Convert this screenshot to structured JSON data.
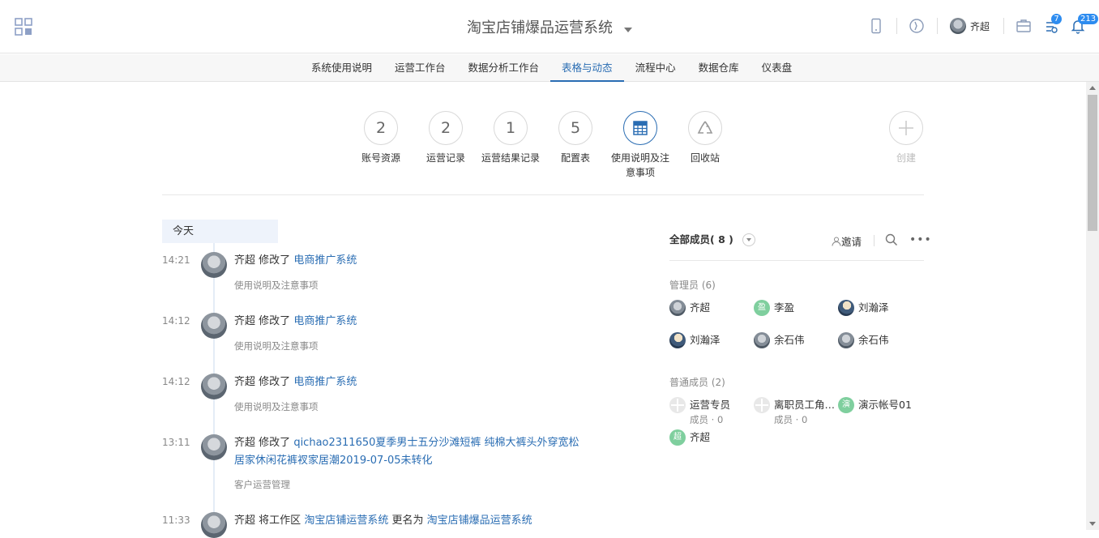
{
  "header": {
    "title": "淘宝店铺爆品运营系统",
    "user_name": "齐超",
    "badge_tasks": "7",
    "badge_notifications": "213"
  },
  "nav": {
    "tabs": [
      {
        "label": "系统使用说明",
        "active": false
      },
      {
        "label": "运营工作台",
        "active": false
      },
      {
        "label": "数据分析工作台",
        "active": false
      },
      {
        "label": "表格与动态",
        "active": true
      },
      {
        "label": "流程中心",
        "active": false
      },
      {
        "label": "数据仓库",
        "active": false
      },
      {
        "label": "仪表盘",
        "active": false
      }
    ]
  },
  "tiles": [
    {
      "value": "2",
      "label": "账号资源"
    },
    {
      "value": "2",
      "label": "运营记录"
    },
    {
      "value": "1",
      "label": "运营结果记录"
    },
    {
      "value": "5",
      "label": "配置表"
    },
    {
      "value": "",
      "label": "使用说明及注意事项",
      "icon": "table-icon"
    },
    {
      "value": "",
      "label": "回收站",
      "icon": "recycle-icon"
    },
    {
      "value": "",
      "label": "创建",
      "icon": "plus-icon"
    }
  ],
  "timeline": {
    "group_label": "今天",
    "items": [
      {
        "time": "14:21",
        "user": "齐超",
        "verb": "修改了",
        "target": "电商推广系统",
        "sub": "使用说明及注意事项"
      },
      {
        "time": "14:12",
        "user": "齐超",
        "verb": "修改了",
        "target": "电商推广系统",
        "sub": "使用说明及注意事项"
      },
      {
        "time": "14:12",
        "user": "齐超",
        "verb": "修改了",
        "target": "电商推广系统",
        "sub": "使用说明及注意事项"
      },
      {
        "time": "13:11",
        "user": "齐超",
        "verb": "修改了",
        "target": "qichao2311650夏季男士五分沙滩短裤 纯棉大裤头外穿宽松 居家休闲花裤衩家居潮2019-07-05未转化",
        "sub": "客户运营管理"
      },
      {
        "time": "11:33",
        "user": "齐超",
        "verb": "将工作区",
        "target": "淘宝店铺运营系统",
        "verb2": "更名为",
        "target2": "淘宝店铺爆品运营系统"
      }
    ]
  },
  "members": {
    "title": "全部成员",
    "count": "( 8 )",
    "invite_label": "邀请",
    "admins_label": "管理员 (6)",
    "admins": [
      {
        "name": "齐超",
        "avatar": "photo",
        "initial": ""
      },
      {
        "name": "李盈",
        "avatar": "green",
        "initial": "盈"
      },
      {
        "name": "刘瀚泽",
        "avatar": "photo2",
        "initial": ""
      },
      {
        "name": "刘瀚泽",
        "avatar": "photo2",
        "initial": ""
      },
      {
        "name": "余石伟",
        "avatar": "photo",
        "initial": ""
      },
      {
        "name": "余石伟",
        "avatar": "photo",
        "initial": ""
      }
    ],
    "regular_label": "普通成员 (2)",
    "regular": [
      {
        "name": "运营专员",
        "sub": "成员 · 0",
        "avatar": "grey",
        "initial": ""
      },
      {
        "name": "离职员工角…",
        "sub": "成员 · 0",
        "avatar": "grey",
        "initial": ""
      },
      {
        "name": "演示帐号01",
        "sub": "",
        "avatar": "green",
        "initial": "演"
      },
      {
        "name": "齐超",
        "sub": "",
        "avatar": "green",
        "initial": "超"
      }
    ]
  },
  "colors": {
    "accent": "#2a6db3",
    "badge": "#2d8cf0",
    "avatar_green": "#7fcf9e"
  }
}
